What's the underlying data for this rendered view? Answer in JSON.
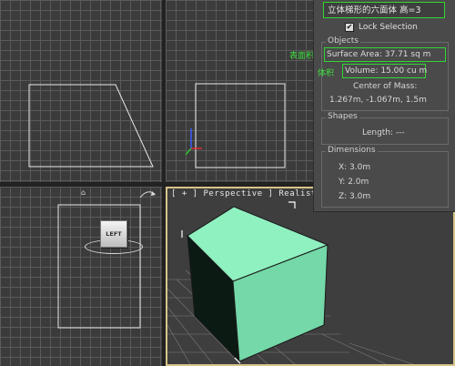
{
  "app": {
    "name_field": "立体梯形的六面体 高=3",
    "lock_selection_label": "Lock Selection",
    "lock_selection_checked": true
  },
  "viewports": {
    "perspective_label": "[ + ] Perspective ] Realistic"
  },
  "nav_cube": {
    "face_label": "LEFT"
  },
  "panel": {
    "objects": {
      "title": "Objects",
      "surface_area": "Surface Area: 37.71 sq m",
      "volume": "Volume: 15.00 cu m",
      "center_of_mass_label": "Center of Mass:",
      "center_of_mass_value": "1.267m, -1.067m, 1.5m"
    },
    "shapes": {
      "title": "Shapes",
      "length": "Length: ---"
    },
    "dimensions": {
      "title": "Dimensions",
      "x": "X:  3.0m",
      "y": "Y:  2.0m",
      "z": "Z:  3.0m"
    }
  },
  "annotations": {
    "surface_area_note": "表面积",
    "volume_note": "体积"
  },
  "colors": {
    "highlight": "#33d633",
    "cube_face": "#7ee0b0",
    "viewport_border": "#d8c48a"
  }
}
